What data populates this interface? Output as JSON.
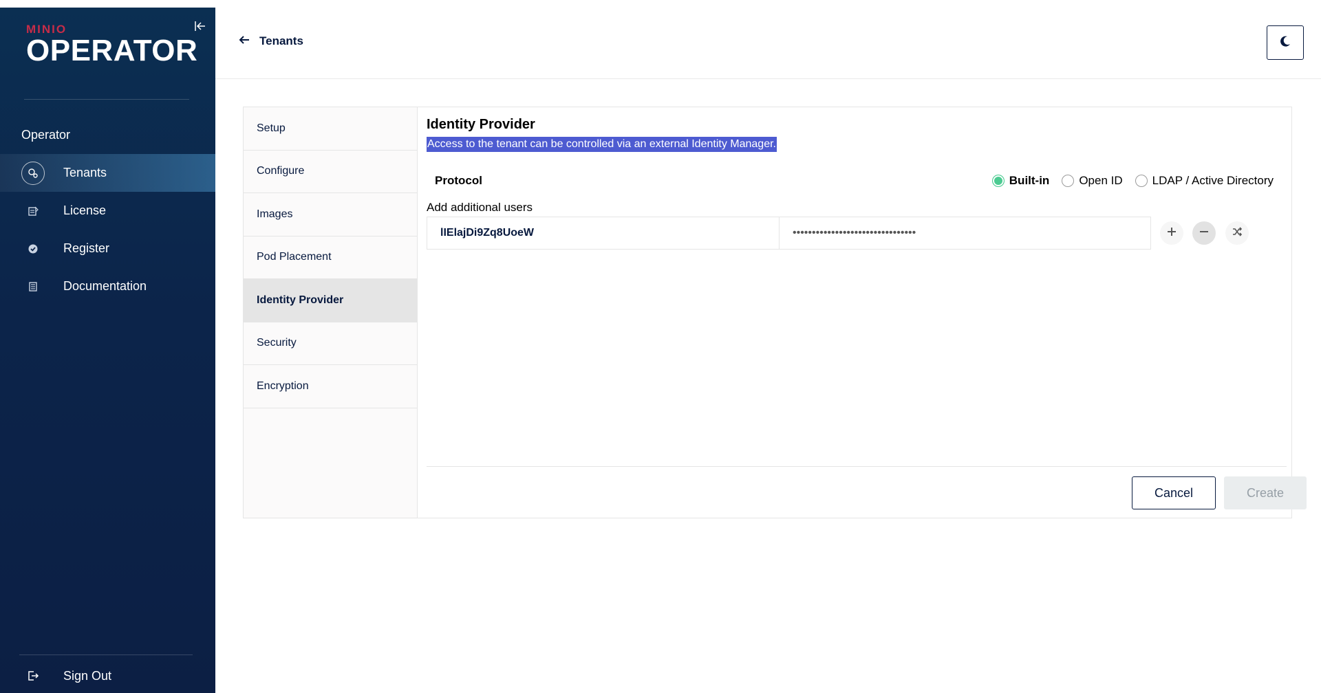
{
  "sidebar": {
    "logo_brand": "MINIO",
    "logo_product": "OPERATOR",
    "section_title": "Operator",
    "items": [
      {
        "label": "Tenants",
        "icon": "tenants-icon",
        "active": true
      },
      {
        "label": "License",
        "icon": "license-icon",
        "active": false
      },
      {
        "label": "Register",
        "icon": "register-icon",
        "active": false
      },
      {
        "label": "Documentation",
        "icon": "documentation-icon",
        "active": false
      }
    ],
    "signout_label": "Sign Out"
  },
  "header": {
    "back_label": "Tenants"
  },
  "wizard": {
    "steps": [
      {
        "label": "Setup"
      },
      {
        "label": "Configure"
      },
      {
        "label": "Images"
      },
      {
        "label": "Pod Placement"
      },
      {
        "label": "Identity Provider",
        "active": true
      },
      {
        "label": "Security"
      },
      {
        "label": "Encryption"
      }
    ],
    "panel": {
      "title": "Identity Provider",
      "description": "Access to the tenant can be controlled via an external Identity Manager.",
      "protocol_label": "Protocol",
      "protocol_options": [
        {
          "label": "Built-in",
          "checked": true
        },
        {
          "label": "Open ID",
          "checked": false
        },
        {
          "label": "LDAP / Active Directory",
          "checked": false
        }
      ],
      "users_label": "Add additional users",
      "user_value": "lIElajDi9Zq8UoeW",
      "password_value": "••••••••••••••••••••••••••••••••"
    },
    "cancel_label": "Cancel",
    "create_label": "Create"
  },
  "colors": {
    "sidebar_bg": "#0c244a",
    "brand_red": "#c72c48",
    "accent_green": "#4ccb92",
    "selection_blue": "#4d5bd1",
    "text_navy": "#07193e"
  }
}
